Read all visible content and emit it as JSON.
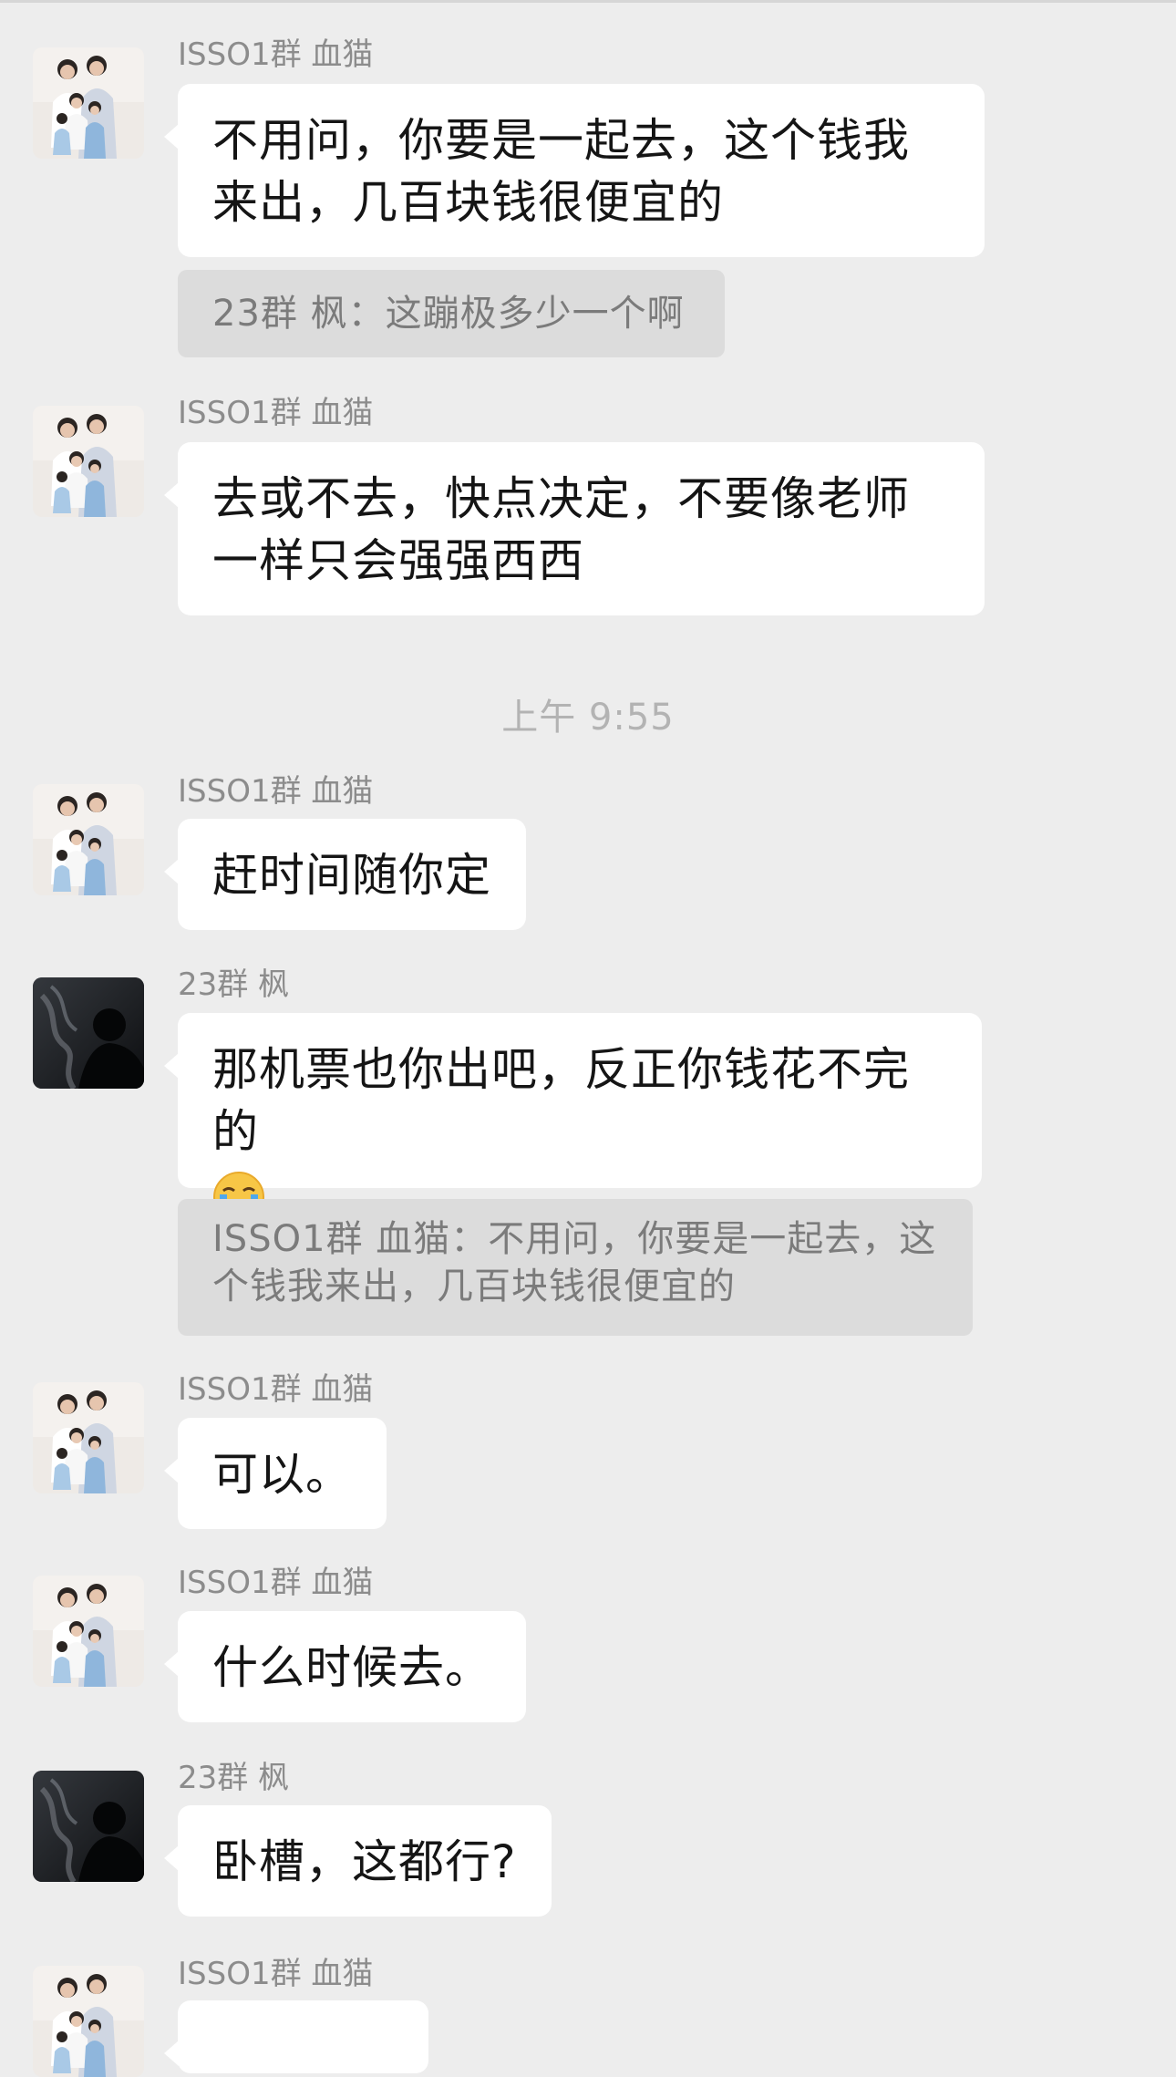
{
  "messages": [
    {
      "sender": "ISSO1群 血猫",
      "text": "不用问，你要是一起去，这个钱我来出，几百块钱很便宜的",
      "quote": "23群 枫：这蹦极多少一个啊"
    },
    {
      "sender": "ISSO1群 血猫",
      "text": "去或不去，快点决定，不要像老师一样只会强强西西"
    },
    {
      "sender": "ISSO1群 血猫",
      "text": "赶时间随你定"
    },
    {
      "sender": "23群 枫",
      "text": "那机票也你出吧，反正你钱花不完的",
      "emoji": "loudly-crying-face",
      "quote": "ISSO1群 血猫：不用问，你要是一起去，这个钱我来出，几百块钱很便宜的"
    },
    {
      "sender": "ISSO1群 血猫",
      "text": "可以。"
    },
    {
      "sender": "ISSO1群 血猫",
      "text": "什么时候去。"
    },
    {
      "sender": "23群 枫",
      "text": "卧槽，这都行?"
    },
    {
      "sender": "ISSO1群 血猫",
      "text": ""
    }
  ],
  "timestamp": "上午 9:55",
  "colors": {
    "background": "#ededed",
    "bubble": "#ffffff",
    "quote_bg": "#dcdcdc",
    "sender_text": "#8c8c8c",
    "timestamp_text": "#b3b3b3"
  }
}
